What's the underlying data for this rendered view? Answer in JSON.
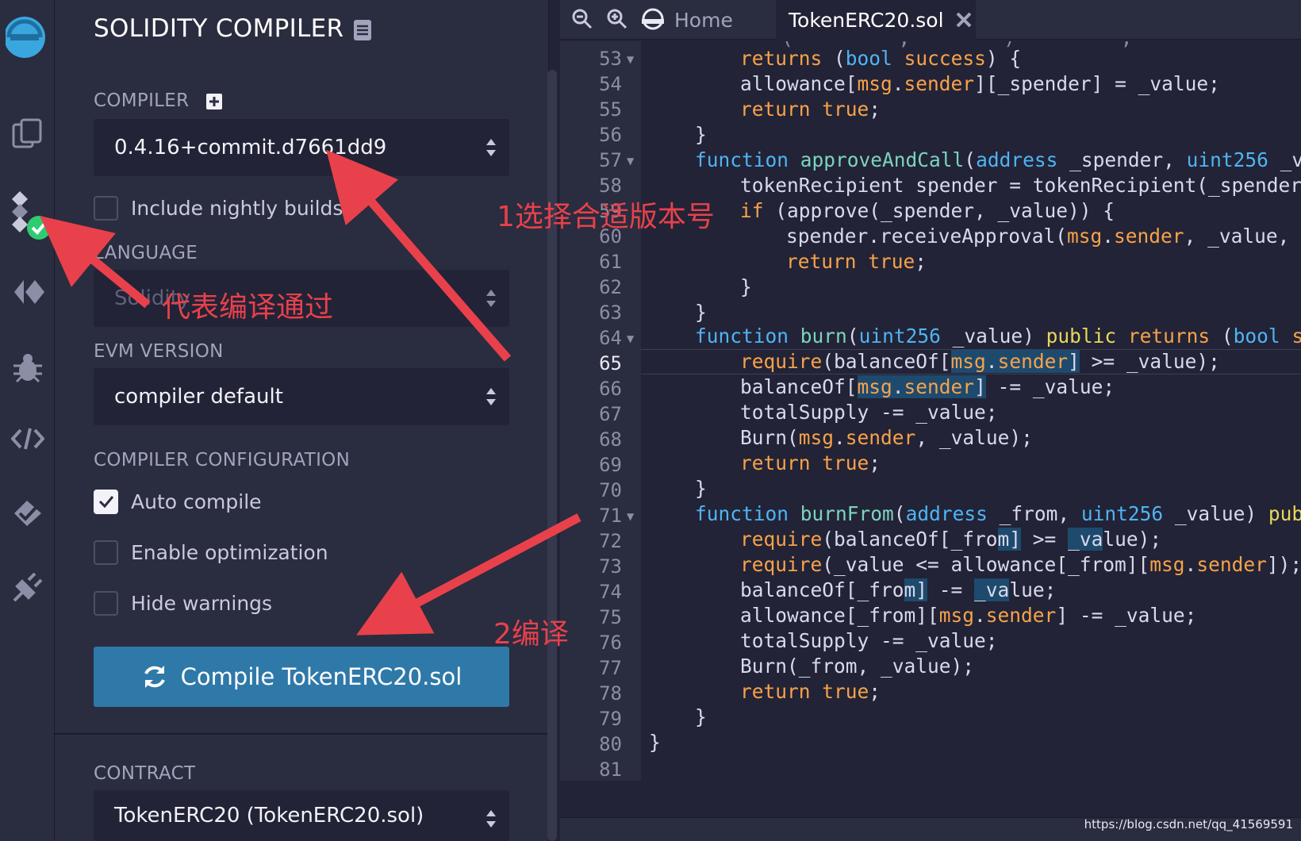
{
  "panel": {
    "title": "SOLIDITY COMPILER",
    "compiler_label": "COMPILER",
    "compiler_version": "0.4.16+commit.d7661dd9",
    "nightly_label": "Include nightly builds",
    "nightly_checked": false,
    "language_label": "LANGUAGE",
    "language_value": "Solidity",
    "evm_label": "EVM VERSION",
    "evm_value": "compiler default",
    "config_label": "COMPILER CONFIGURATION",
    "options": [
      {
        "label": "Auto compile",
        "checked": true
      },
      {
        "label": "Enable optimization",
        "checked": false
      },
      {
        "label": "Hide warnings",
        "checked": false
      }
    ],
    "compile_button": "Compile TokenERC20.sol",
    "contract_label": "CONTRACT",
    "contract_value": "TokenERC20 (TokenERC20.sol)"
  },
  "editor": {
    "home_tab": "Home",
    "file_tab": "TokenERC20.sol",
    "active_line": 65,
    "line_numbers": [
      "53",
      "54",
      "55",
      "56",
      "57",
      "58",
      "59",
      "60",
      "61",
      "62",
      "63",
      "64",
      "65",
      "66",
      "67",
      "68",
      "69",
      "70",
      "71",
      "72",
      "73",
      "74",
      "75",
      "76",
      "77",
      "78",
      "79",
      "80",
      "81"
    ]
  },
  "annotations": {
    "select_version": "1选择合适版本号",
    "compile_passed": "代表编译通过",
    "compile_step": "2编译"
  },
  "watermark": "https://blog.csdn.net/qq_41569591",
  "colors": {
    "background": "#222336",
    "panel": "#2a2c3f",
    "button": "#2f79a9",
    "success_badge": "#2ecc71",
    "annotation": "#e8414b"
  }
}
